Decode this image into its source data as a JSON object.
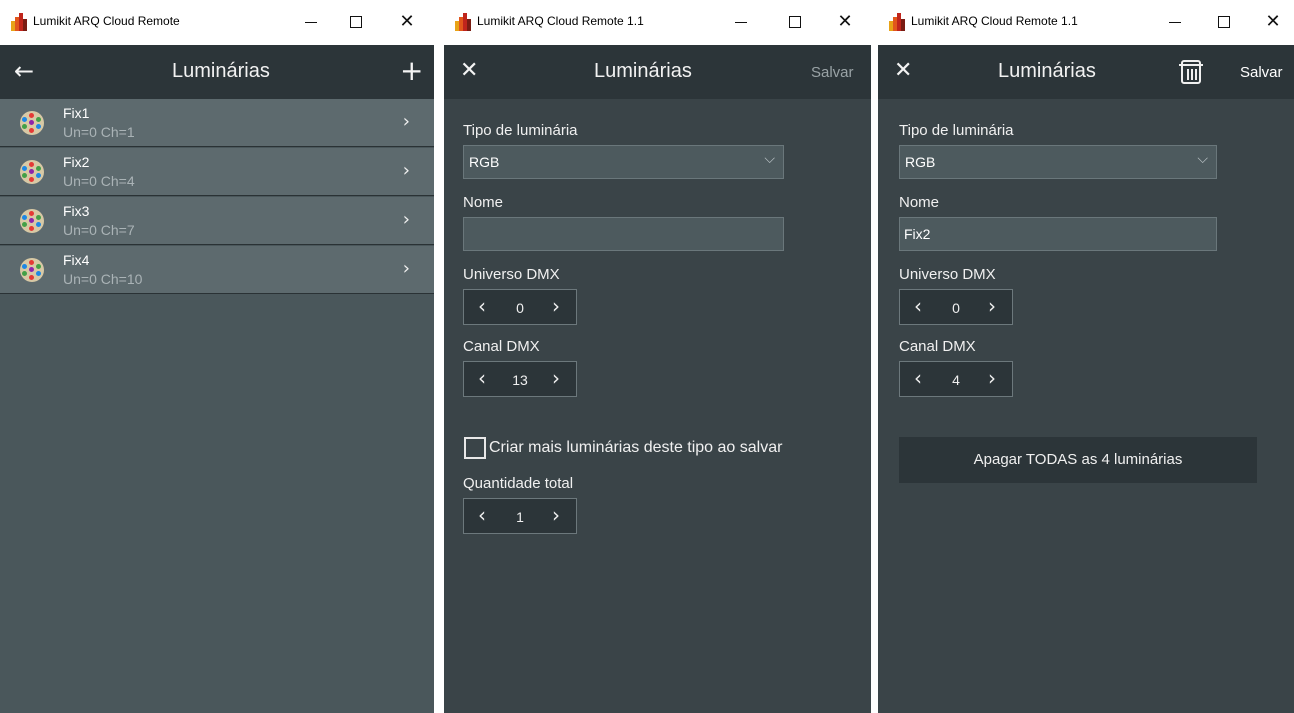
{
  "window1": {
    "title": "Lumikit ARQ Cloud Remote",
    "header": {
      "title": "Luminárias",
      "back_icon": "arrow-left-icon",
      "add_icon": "plus-icon"
    },
    "items": [
      {
        "name": "Fix1",
        "sub": "Un=0 Ch=1"
      },
      {
        "name": "Fix2",
        "sub": "Un=0 Ch=4"
      },
      {
        "name": "Fix3",
        "sub": "Un=0 Ch=7"
      },
      {
        "name": "Fix4",
        "sub": "Un=0 Ch=10"
      }
    ]
  },
  "window2": {
    "title": "Lumikit ARQ Cloud Remote 1.1",
    "header": {
      "title": "Luminárias",
      "save_label": "Salvar",
      "save_color": "#9aa3a6"
    },
    "form": {
      "type_label": "Tipo de luminária",
      "type_value": "RGB",
      "name_label": "Nome",
      "name_value": "",
      "universe_label": "Universo DMX",
      "universe_value": "0",
      "channel_label": "Canal DMX",
      "channel_value": "13",
      "create_more_label": "Criar mais luminárias deste tipo ao salvar",
      "create_more_checked": false,
      "quantity_label": "Quantidade total",
      "quantity_value": "1"
    }
  },
  "window3": {
    "title": "Lumikit ARQ Cloud Remote 1.1",
    "header": {
      "title": "Luminárias",
      "save_label": "Salvar",
      "save_color": "#ffffff"
    },
    "form": {
      "type_label": "Tipo de luminária",
      "type_value": "RGB",
      "name_label": "Nome",
      "name_value": "Fix2",
      "universe_label": "Universo DMX",
      "universe_value": "0",
      "channel_label": "Canal DMX",
      "channel_value": "4",
      "delete_all_label": "Apagar TODAS as 4 luminárias"
    }
  },
  "glyphs": {
    "minimize": "",
    "maximize": "",
    "close": "✕",
    "back": "←",
    "add": "+",
    "cancel": "✕",
    "chevron_right": "›",
    "chevron_left": "‹",
    "chevron_down": "⌵"
  },
  "colors": {
    "appbar": "#2c3539",
    "panel": "#3a4448",
    "list_item": "#5d6a6e"
  }
}
